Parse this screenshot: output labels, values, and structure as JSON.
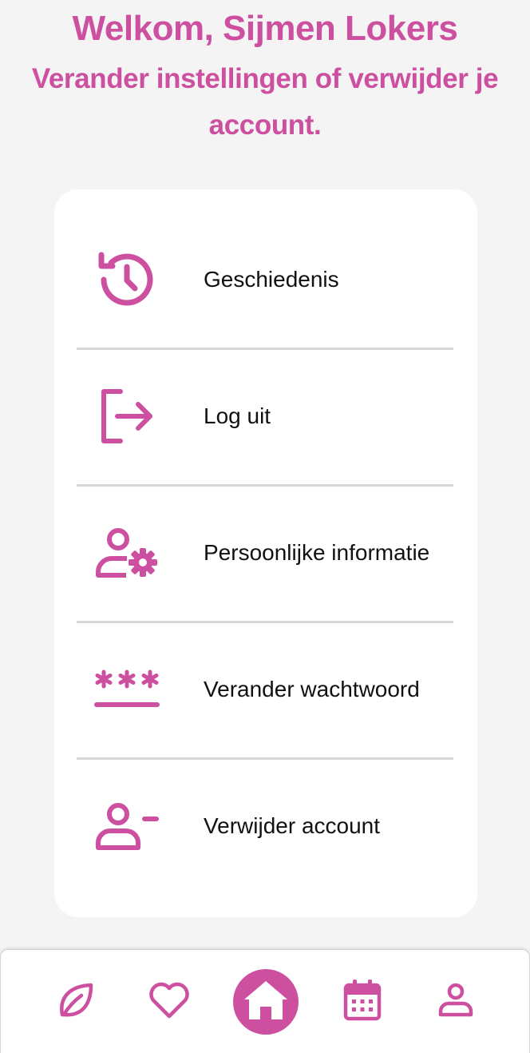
{
  "header": {
    "title": "Welkom, Sijmen Lokers",
    "subtitle": "Verander instellingen of verwijder je account."
  },
  "menu": {
    "items": [
      {
        "label": "Geschiedenis",
        "icon": "history-icon"
      },
      {
        "label": "Log uit",
        "icon": "logout-icon"
      },
      {
        "label": "Persoonlijke informatie",
        "icon": "user-settings-icon"
      },
      {
        "label": "Verander wachtwoord",
        "icon": "password-icon"
      },
      {
        "label": "Verwijder account",
        "icon": "user-remove-icon"
      }
    ]
  },
  "bottom_nav": {
    "items": [
      {
        "icon": "leaf-icon",
        "active": false
      },
      {
        "icon": "heart-icon",
        "active": false
      },
      {
        "icon": "home-icon",
        "active": true
      },
      {
        "icon": "calendar-icon",
        "active": false
      },
      {
        "icon": "profile-icon",
        "active": false
      }
    ]
  },
  "colors": {
    "accent": "#cc4fa0",
    "background": "#f4f4f4",
    "card": "#ffffff",
    "text": "#111111",
    "divider": "#d7d7d7"
  }
}
